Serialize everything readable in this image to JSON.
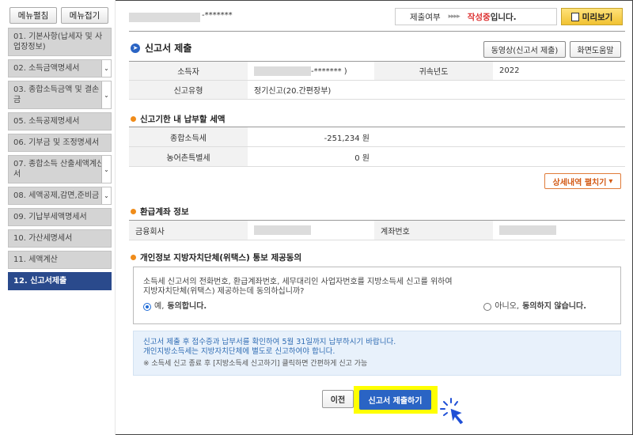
{
  "sidebar": {
    "toggle": {
      "expand": "메뉴펼침",
      "collapse": "메뉴접기"
    },
    "items": [
      {
        "label": "01. 기본사항(납세자 및 사업장정보)",
        "chevron": false,
        "active": false
      },
      {
        "label": "02. 소득금액명세서",
        "chevron": true,
        "active": false
      },
      {
        "label": "03. 종합소득금액 및 결손금",
        "chevron": true,
        "active": false
      },
      {
        "label": "05. 소득공제명세서",
        "chevron": false,
        "active": false
      },
      {
        "label": "06. 기부금 및 조정명세서",
        "chevron": false,
        "active": false
      },
      {
        "label": "07. 종합소득 산출세액계산서",
        "chevron": true,
        "active": false
      },
      {
        "label": "08. 세액공제,감면,준비금",
        "chevron": true,
        "active": false
      },
      {
        "label": "09. 기납부세액명세서",
        "chevron": false,
        "active": false
      },
      {
        "label": "10. 가산세명세서",
        "chevron": false,
        "active": false
      },
      {
        "label": "11. 세액계산",
        "chevron": false,
        "active": false
      },
      {
        "label": "12. 신고서제출",
        "chevron": false,
        "active": true
      }
    ]
  },
  "topbar": {
    "masked_suffix": "-*******",
    "status_label": "제출여부",
    "status_arrows": "▸▸▸▸",
    "status_value": "작성중",
    "status_suffix": "입니다.",
    "preview_label": "미리보기"
  },
  "section": {
    "title": "신고서 제출",
    "video_button": "동영상(신고서 제출)",
    "help_button": "화면도움말"
  },
  "info": {
    "taxpayer_label": "소득자",
    "taxpayer_value": "-*******   )",
    "year_label": "귀속년도",
    "year_value": "2022",
    "type_label": "신고유형",
    "type_value": "정기신고(20.간편장부)"
  },
  "tax": {
    "heading": "신고기한 내 납부할 세액",
    "income_tax_label": "종합소득세",
    "income_tax_value": "-251,234 원",
    "rural_tax_label": "농어촌특별세",
    "rural_tax_value": "0 원",
    "detail_button": "상세내역 펼치기"
  },
  "refund": {
    "heading": "환급계좌 정보",
    "bank_label": "금융회사",
    "account_label": "계좌번호"
  },
  "consent": {
    "heading": "개인정보 지방자치단체(위택스) 통보 제공동의",
    "text_line1": "소득세 신고서의 전화번호, 환급계좌번호, 세무대리인 사업자번호를 지방소득세 신고를 위하여",
    "text_line2": "지방자치단체(위택스) 제공하는데 동의하십니까?",
    "yes_prefix": "예,",
    "yes_label": "동의합니다.",
    "no_prefix": "아니오,",
    "no_label": "동의하지 않습니다.",
    "selected": "yes"
  },
  "notice": {
    "line1": "신고서 제출 후 접수증과 납부서를 확인하여 5월 31일까지 납부하시기 바랍니다.",
    "line2": "개인지방소득세는 지방자치단체에 별도로 신고하여야 합니다.",
    "line3": "※ 소득세 신고 종료 후 [지방소득세 신고하기] 클릭하면 간편하게 신고 가능"
  },
  "actions": {
    "prev": "이전",
    "submit": "신고서 제출하기"
  },
  "colors": {
    "active_menu": "#2a4a8c",
    "primary_button": "#2a64c4",
    "highlight": "#ffff00",
    "status_red": "#dd3333",
    "section_dot": "#f08c1a"
  }
}
